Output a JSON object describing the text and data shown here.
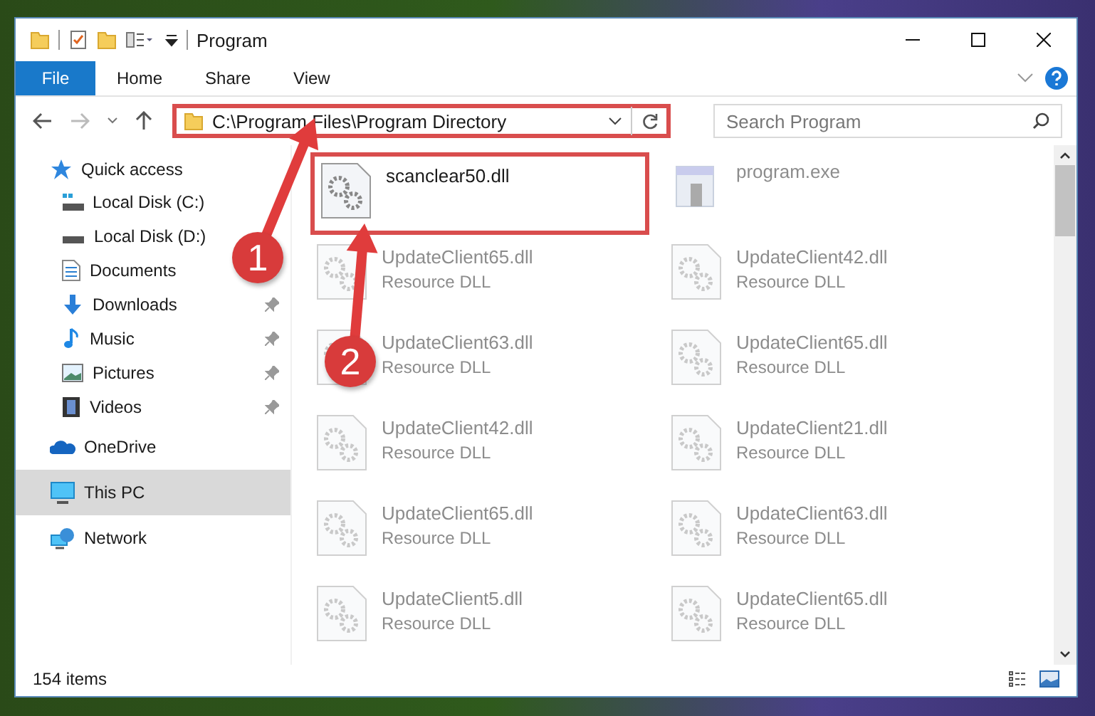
{
  "window": {
    "title": "Program"
  },
  "ribbon_tabs": [
    {
      "label": "File",
      "kind": "file"
    },
    {
      "label": "Home",
      "kind": "tab"
    },
    {
      "label": "Share",
      "kind": "tab"
    },
    {
      "label": "View",
      "kind": "tab"
    }
  ],
  "address": {
    "path": "C:\\Program Files\\Program Directory",
    "highlighted": true
  },
  "search": {
    "placeholder": "Search Program"
  },
  "sidebar": {
    "items": [
      {
        "label": "Quick access",
        "kind": "star",
        "selected": false,
        "children": [
          {
            "label": "Local Disk (C:)",
            "kind": "disk_c",
            "pinned": false,
            "selected": false
          },
          {
            "label": "Local Disk (D:)",
            "kind": "disk",
            "pinned": false,
            "selected": false
          },
          {
            "label": "Documents",
            "kind": "documents",
            "pinned": false,
            "selected": false
          },
          {
            "label": "Downloads",
            "kind": "downloads",
            "pinned": true,
            "selected": false
          },
          {
            "label": "Music",
            "kind": "music",
            "pinned": true,
            "selected": false
          },
          {
            "label": "Pictures",
            "kind": "pictures",
            "pinned": true,
            "selected": false
          },
          {
            "label": "Videos",
            "kind": "videos",
            "pinned": true,
            "selected": false
          }
        ]
      },
      {
        "label": "OneDrive",
        "kind": "cloud",
        "selected": false
      },
      {
        "label": "This PC",
        "kind": "pc",
        "selected": true
      },
      {
        "label": "Network",
        "kind": "network",
        "selected": false
      }
    ]
  },
  "files": [
    {
      "name": "scanclear50.dll",
      "kind": "dll",
      "faded": false,
      "highlighted": true
    },
    {
      "name": "program.exe",
      "kind": "exe",
      "faded": true,
      "highlighted": false
    },
    {
      "name": "UpdateClient65.dll",
      "type": "Resource DLL",
      "kind": "dll",
      "faded": true,
      "highlighted": false
    },
    {
      "name": "UpdateClient42.dll",
      "type": "Resource DLL",
      "kind": "dll",
      "faded": true,
      "highlighted": false
    },
    {
      "name": "UpdateClient63.dll",
      "type": "Resource DLL",
      "kind": "dll",
      "faded": true,
      "highlighted": false
    },
    {
      "name": "UpdateClient65.dll",
      "type": "Resource DLL",
      "kind": "dll",
      "faded": true,
      "highlighted": false
    },
    {
      "name": "UpdateClient42.dll",
      "type": "Resource DLL",
      "kind": "dll",
      "faded": true,
      "highlighted": false
    },
    {
      "name": "UpdateClient21.dll",
      "type": "Resource DLL",
      "kind": "dll",
      "faded": true,
      "highlighted": false
    },
    {
      "name": "UpdateClient65.dll",
      "type": "Resource DLL",
      "kind": "dll",
      "faded": true,
      "highlighted": false
    },
    {
      "name": "UpdateClient63.dll",
      "type": "Resource DLL",
      "kind": "dll",
      "faded": true,
      "highlighted": false
    },
    {
      "name": "UpdateClient5.dll",
      "type": "Resource DLL",
      "kind": "dll",
      "faded": true,
      "highlighted": false
    },
    {
      "name": "UpdateClient65.dll",
      "type": "Resource DLL",
      "kind": "dll",
      "faded": true,
      "highlighted": false
    }
  ],
  "status_bar": {
    "count": "154 items"
  },
  "callouts": [
    {
      "label": "1"
    },
    {
      "label": "2"
    }
  ]
}
